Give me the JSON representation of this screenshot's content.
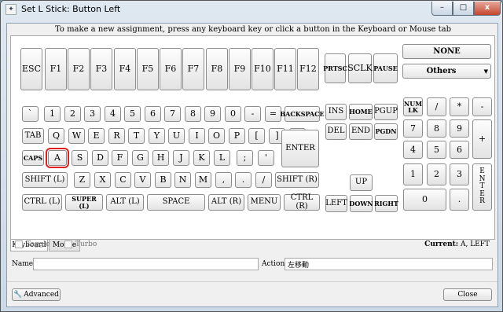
{
  "window": {
    "title": "Set L Stick: Button Left",
    "minimize": "–",
    "maximize": "□",
    "close": "x"
  },
  "instruction": "To make a new assignment, press any keyboard key or click a button in the Keyboard or Mouse tab",
  "keyboard": {
    "fn_row": [
      "ESC",
      "F1",
      "F2",
      "F3",
      "F4",
      "F5",
      "F6",
      "F7",
      "F8",
      "F9",
      "F10",
      "F11",
      "F12"
    ],
    "sys_keys": [
      "PRTSC",
      "SCLK",
      "PAUSE"
    ],
    "none_button": "NONE",
    "others_dropdown": "Others",
    "num_row": [
      "`",
      "1",
      "2",
      "3",
      "4",
      "5",
      "6",
      "7",
      "8",
      "9",
      "0",
      "-",
      "=",
      "BACKSPACE"
    ],
    "tab_row": [
      "TAB",
      "Q",
      "W",
      "E",
      "R",
      "T",
      "Y",
      "U",
      "I",
      "O",
      "P",
      "[",
      "]",
      "\\"
    ],
    "caps_row": [
      "CAPS",
      "A",
      "S",
      "D",
      "F",
      "G",
      "H",
      "J",
      "K",
      "L",
      ";",
      "'"
    ],
    "enter": "ENTER",
    "shift_row": [
      "SHIFT (L)",
      "Z",
      "X",
      "C",
      "V",
      "B",
      "N",
      "M",
      ",",
      ".",
      "/",
      "SHIFT (R)"
    ],
    "bottom_row": [
      "CTRL (L)",
      "SUPER (L)",
      "ALT (L)",
      "SPACE",
      "ALT (R)",
      "MENU",
      "CTRL (R)"
    ],
    "nav_top": [
      "INS",
      "HOME",
      "PGUP"
    ],
    "nav_bottom": [
      "DEL",
      "END",
      "PGDN"
    ],
    "arrows": [
      "UP",
      "LEFT",
      "DOWN",
      "RIGHT"
    ],
    "numpad_top": [
      "NUM\nLK",
      "/",
      "*",
      "-"
    ],
    "numpad_rows": [
      [
        "7",
        "8",
        "9"
      ],
      [
        "4",
        "5",
        "6"
      ],
      [
        "1",
        "2",
        "3"
      ]
    ],
    "numpad_plus": "+",
    "numpad_zero": "0",
    "numpad_dot": ".",
    "numpad_enter": "E\nN\nT\nE\nR",
    "selected_key": "A"
  },
  "tabs": {
    "keyboard": "Keyboard",
    "mouse": "Mouse"
  },
  "options": {
    "toggle": "Toggle",
    "turbo": "Turbo"
  },
  "current": {
    "label": "Current:",
    "value": "A, LEFT"
  },
  "name": {
    "label": "Name:",
    "value": ""
  },
  "action": {
    "label": "Action:",
    "value": "左移動"
  },
  "buttons": {
    "advanced": "Advanced",
    "close": "Close"
  }
}
